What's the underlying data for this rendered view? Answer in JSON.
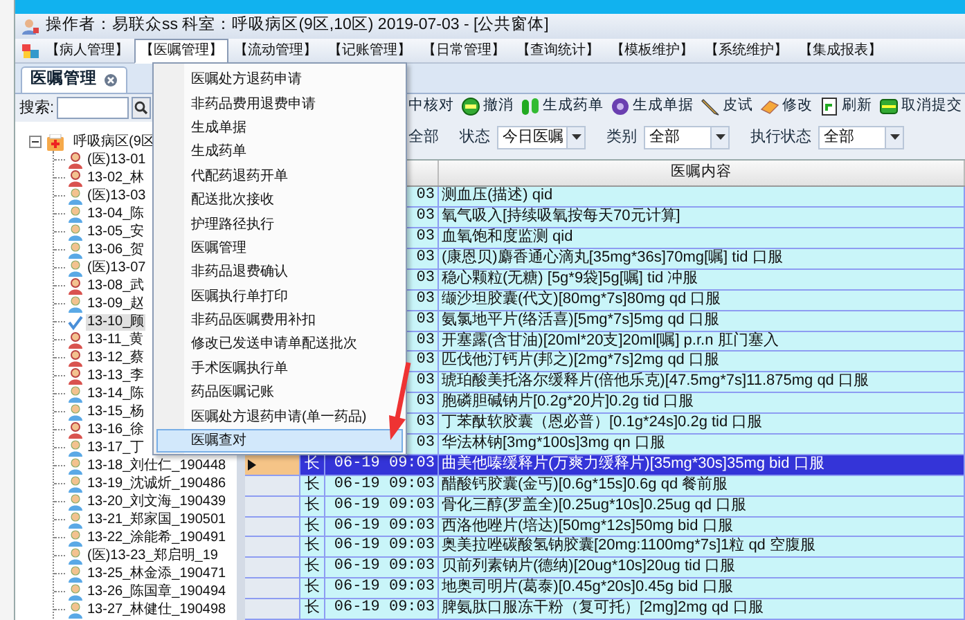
{
  "header": {
    "info_text": "操作者：易联众ss  科室：呼吸病区(9区,10区)  2019-07-03 - [公共窗体]"
  },
  "menu_bar": {
    "items": [
      {
        "label": "【病人管理】",
        "selected": false
      },
      {
        "label": "【医嘱管理】",
        "selected": true
      },
      {
        "label": "【流动管理】",
        "selected": false
      },
      {
        "label": "【记账管理】",
        "selected": false
      },
      {
        "label": "【日常管理】",
        "selected": false
      },
      {
        "label": "【查询统计】",
        "selected": false
      },
      {
        "label": "【模板维护】",
        "selected": false
      },
      {
        "label": "【系统维护】",
        "selected": false
      },
      {
        "label": "【集成报表】",
        "selected": false
      }
    ]
  },
  "menu_dropdown": {
    "items": [
      {
        "label": "医嘱处方退药申请",
        "selected": false
      },
      {
        "label": "非药品费用退费申请",
        "selected": false
      },
      {
        "label": "生成单据",
        "selected": false
      },
      {
        "label": "生成药单",
        "selected": false
      },
      {
        "label": "代配药退药开单",
        "selected": false
      },
      {
        "label": "配送批次接收",
        "selected": false
      },
      {
        "label": "护理路径执行",
        "selected": false
      },
      {
        "label": "医嘱管理",
        "selected": false
      },
      {
        "label": "非药品退费确认",
        "selected": false
      },
      {
        "label": "医嘱执行单打印",
        "selected": false
      },
      {
        "label": "非药品医嘱费用补扣",
        "selected": false
      },
      {
        "label": "修改已发送申请单配送批次",
        "selected": false
      },
      {
        "label": "手术医嘱执行单",
        "selected": false
      },
      {
        "label": "药品医嘱记账",
        "selected": false
      },
      {
        "label": "医嘱处方退药申请(单一药品)",
        "selected": false
      },
      {
        "label": "医嘱查对",
        "selected": true
      }
    ]
  },
  "tabs": [
    {
      "label": "医嘱管理",
      "selected": true
    }
  ],
  "search": {
    "label": "搜索:"
  },
  "toolbar": [
    {
      "label": "中核对"
    },
    {
      "label": "撤消",
      "kind": "cancel"
    },
    {
      "label": "生成药单",
      "kind": "capsule"
    },
    {
      "label": "生成单据",
      "kind": "gear"
    },
    {
      "label": "皮试",
      "kind": "pencil"
    },
    {
      "label": "修改",
      "kind": "eraser"
    },
    {
      "label": "刷新",
      "kind": "refresh"
    },
    {
      "label": "取消提交",
      "kind": "stack"
    }
  ],
  "filters": {
    "leading_value": "全部",
    "items": [
      {
        "label": "状态",
        "value": "今日医嘱"
      },
      {
        "label": "类别",
        "value": "全部"
      },
      {
        "label": "执行状态",
        "value": "全部"
      }
    ]
  },
  "tree": {
    "root": {
      "label": "呼吸病区(9区",
      "expanded": true,
      "children": [
        {
          "label": "(医)13-01",
          "kind": "female",
          "selected": false
        },
        {
          "label": "13-02_林",
          "kind": "female",
          "selected": false
        },
        {
          "label": "(医)13-03",
          "kind": "male",
          "selected": false
        },
        {
          "label": "13-04_陈",
          "kind": "male",
          "selected": false
        },
        {
          "label": "13-05_安",
          "kind": "male",
          "selected": false
        },
        {
          "label": "13-06_贺",
          "kind": "male",
          "selected": false
        },
        {
          "label": "(医)13-07",
          "kind": "male",
          "selected": false
        },
        {
          "label": "13-08_武",
          "kind": "female",
          "selected": false
        },
        {
          "label": "13-09_赵",
          "kind": "male",
          "selected": false
        },
        {
          "label": "13-10_顾",
          "kind": "checked",
          "selected": true
        },
        {
          "label": "13-11_黄",
          "kind": "female",
          "selected": false
        },
        {
          "label": "13-12_蔡",
          "kind": "female",
          "selected": false
        },
        {
          "label": "13-13_李",
          "kind": "female",
          "selected": false
        },
        {
          "label": "13-14_陈",
          "kind": "male",
          "selected": false
        },
        {
          "label": "13-15_杨",
          "kind": "male",
          "selected": false
        },
        {
          "label": "13-16_徐",
          "kind": "female",
          "selected": false
        },
        {
          "label": "13-17_丁",
          "kind": "male",
          "selected": false
        },
        {
          "label": "13-18_刘仕仁_190448",
          "kind": "male",
          "selected": false
        },
        {
          "label": "13-19_沈诚炘_190486",
          "kind": "male",
          "selected": false
        },
        {
          "label": "13-20_刘文海_190439",
          "kind": "male",
          "selected": false
        },
        {
          "label": "13-21_郑家国_190501",
          "kind": "male",
          "selected": false
        },
        {
          "label": "13-22_涂能希_190491",
          "kind": "male",
          "selected": false
        },
        {
          "label": "(医)13-23_郑启明_19",
          "kind": "male",
          "selected": false
        },
        {
          "label": "13-25_林金添_190471",
          "kind": "male",
          "selected": false
        },
        {
          "label": "13-26_陈国章_190494",
          "kind": "male",
          "selected": false
        },
        {
          "label": "13-27_林健仕_190498",
          "kind": "male",
          "selected": false
        }
      ]
    }
  },
  "grid": {
    "columns": [
      {
        "label": "医嘱内容"
      }
    ],
    "rows": [
      {
        "time": "03",
        "content": "测血压(描述) qid",
        "selected": false
      },
      {
        "time": "03",
        "content": "氧气吸入[持续吸氧按每天70元计算]",
        "selected": false
      },
      {
        "time": "03",
        "content": "血氧饱和度监测 qid",
        "selected": false
      },
      {
        "time": "03",
        "content": "(康恩贝)麝香通心滴丸[35mg*36s]70mg[嘱] tid 口服",
        "selected": false
      },
      {
        "time": "03",
        "content": "稳心颗粒(无糖) [5g*9袋]5g[嘱] tid 冲服",
        "selected": false
      },
      {
        "time": "03",
        "content": "缬沙坦胶囊(代文)[80mg*7s]80mg qd 口服",
        "selected": false
      },
      {
        "time": "03",
        "content": "氨氯地平片(络活喜)[5mg*7s]5mg qd 口服",
        "selected": false
      },
      {
        "time": "03",
        "content": "开塞露(含甘油)[20ml*20支]20ml[嘱] p.r.n 肛门塞入",
        "selected": false
      },
      {
        "time": "03",
        "content": "匹伐他汀钙片(邦之)[2mg*7s]2mg qd 口服",
        "selected": false
      },
      {
        "time": "03",
        "content": "琥珀酸美托洛尔缓释片(倍他乐克)[47.5mg*7s]11.875mg qd 口服",
        "selected": false
      },
      {
        "time": "03",
        "content": "胞磷胆碱钠片[0.2g*20片]0.2g tid 口服",
        "selected": false
      },
      {
        "time": "03",
        "content": "丁苯酞软胶囊（恩必普）[0.1g*24s]0.2g tid 口服",
        "selected": false
      },
      {
        "time": "03",
        "content": "华法林钠[3mg*100s]3mg qn 口服",
        "selected": false
      },
      {
        "type": "长",
        "time": "06-19 09:03",
        "content": "曲美他嗪缓释片(万爽力缓释片)[35mg*30s]35mg bid 口服",
        "selected": true
      },
      {
        "type": "长",
        "time": "06-19 09:03",
        "content": "醋酸钙胶囊(金丐)[0.6g*15s]0.6g qd 餐前服",
        "selected": false
      },
      {
        "type": "长",
        "time": "06-19 09:03",
        "content": "骨化三醇(罗盖全)[0.25ug*10s]0.25ug qd 口服",
        "selected": false
      },
      {
        "type": "长",
        "time": "06-19 09:03",
        "content": "西洛他唑片(培达)[50mg*12s]50mg bid 口服",
        "selected": false
      },
      {
        "type": "长",
        "time": "06-19 09:03",
        "content": "奥美拉唑碳酸氢钠胶囊[20mg:1100mg*7s]1粒 qd 空腹服",
        "selected": false
      },
      {
        "type": "长",
        "time": "06-19 09:03",
        "content": "贝前列素钠片(德纳)[20ug*10s]20ug tid 口服",
        "selected": false
      },
      {
        "type": "长",
        "time": "06-19 09:03",
        "content": "地奥司明片(葛泰)[0.45g*20s]0.45g bid 口服",
        "selected": false
      },
      {
        "type": "长",
        "time": "06-19 09:03",
        "content": "脾氨肽口服冻干粉（复可托）[2mg]2mg qd 口服",
        "selected": false
      }
    ]
  }
}
